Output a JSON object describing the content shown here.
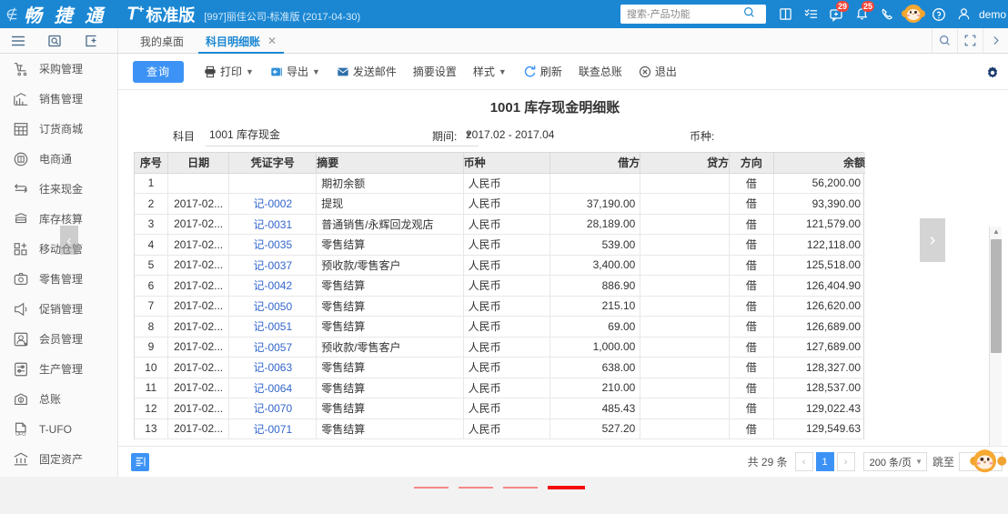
{
  "topbar": {
    "back_icon": "back-arrow-icon",
    "brand_cn": "畅 捷 通",
    "brand_t": "T",
    "brand_t_sup": "+",
    "brand_edition": "标准版",
    "company": "[997]丽佳公司-标准版  (2017-04-30)",
    "search_placeholder": "搜索-产品功能",
    "icons": [
      {
        "name": "save-icon",
        "badge": ""
      },
      {
        "name": "task-list-icon",
        "badge": ""
      },
      {
        "name": "message-icon",
        "badge": "29"
      },
      {
        "name": "bell-icon",
        "badge": "25"
      },
      {
        "name": "phone-icon",
        "badge": ""
      },
      {
        "name": "monkey-mascot-icon",
        "badge": ""
      },
      {
        "name": "help-icon",
        "badge": ""
      },
      {
        "name": "user-icon",
        "badge": ""
      }
    ],
    "username": "demo"
  },
  "tabrow": {
    "left_icons": [
      "menu-icon",
      "search-doc-icon",
      "add-doc-icon"
    ],
    "tabs": [
      {
        "label": "我的桌面",
        "active": false,
        "closable": false
      },
      {
        "label": "科目明细账",
        "active": true,
        "closable": true
      }
    ],
    "close_glyph": "✕",
    "right_icons": [
      "search-icon",
      "fullscreen-icon",
      "chevron-right-icon"
    ]
  },
  "sidebar": {
    "items": [
      {
        "label": "采购管理",
        "icon": "cart-icon"
      },
      {
        "label": "销售管理",
        "icon": "chart-up-icon"
      },
      {
        "label": "订货商城",
        "icon": "shop-icon"
      },
      {
        "label": "电商通",
        "icon": "ecommerce-icon"
      },
      {
        "label": "往来现金",
        "icon": "exchange-icon"
      },
      {
        "label": "库存核算",
        "icon": "inventory-icon"
      },
      {
        "label": "移动仓管",
        "icon": "grid-plus-icon"
      },
      {
        "label": "零售管理",
        "icon": "retail-icon"
      },
      {
        "label": "促销管理",
        "icon": "megaphone-icon"
      },
      {
        "label": "会员管理",
        "icon": "member-icon"
      },
      {
        "label": "生产管理",
        "icon": "production-icon"
      },
      {
        "label": "总账",
        "icon": "ledger-icon"
      },
      {
        "label": "T-UFO",
        "icon": "ufo-icon"
      },
      {
        "label": "固定资产",
        "icon": "bank-icon"
      }
    ],
    "collapse_glyph": "‹"
  },
  "toolbar": {
    "query_label": "查询",
    "items": [
      {
        "label": "打印",
        "icon": "printer-icon",
        "caret": true
      },
      {
        "label": "导出",
        "icon": "export-icon",
        "caret": true
      },
      {
        "label": "发送邮件",
        "icon": "mail-icon",
        "caret": false
      },
      {
        "label": "摘要设置",
        "icon": "",
        "caret": false
      },
      {
        "label": "样式",
        "icon": "",
        "caret": true
      },
      {
        "label": "刷新",
        "icon": "refresh-icon",
        "caret": false
      },
      {
        "label": "联查总账",
        "icon": "",
        "caret": false
      },
      {
        "label": "退出",
        "icon": "exit-icon",
        "caret": false
      }
    ],
    "gear_icon": "gear-icon"
  },
  "report": {
    "title": "1001 库存现金明细账",
    "subject_label": "科目",
    "subject_value": "1001 库存现金",
    "period_label": "期间:",
    "period_value": "2017.02 - 2017.04",
    "currency_label": "币种:"
  },
  "table": {
    "columns": [
      "序号",
      "日期",
      "凭证字号",
      "摘要",
      "币种",
      "借方",
      "贷方",
      "方向",
      "余额"
    ],
    "rows": [
      {
        "seq": "1",
        "date": "",
        "voucher": "",
        "digest": "期初余额",
        "currency": "人民币",
        "debit": "",
        "credit": "",
        "dir": "借",
        "balance": "56,200.00"
      },
      {
        "seq": "2",
        "date": "2017-02...",
        "voucher": "记-0002",
        "digest": "提现",
        "currency": "人民币",
        "debit": "37,190.00",
        "credit": "",
        "dir": "借",
        "balance": "93,390.00"
      },
      {
        "seq": "3",
        "date": "2017-02...",
        "voucher": "记-0031",
        "digest": "普通销售/永辉回龙观店",
        "currency": "人民币",
        "debit": "28,189.00",
        "credit": "",
        "dir": "借",
        "balance": "121,579.00"
      },
      {
        "seq": "4",
        "date": "2017-02...",
        "voucher": "记-0035",
        "digest": "零售结算",
        "currency": "人民币",
        "debit": "539.00",
        "credit": "",
        "dir": "借",
        "balance": "122,118.00"
      },
      {
        "seq": "5",
        "date": "2017-02...",
        "voucher": "记-0037",
        "digest": "预收款/零售客户",
        "currency": "人民币",
        "debit": "3,400.00",
        "credit": "",
        "dir": "借",
        "balance": "125,518.00"
      },
      {
        "seq": "6",
        "date": "2017-02...",
        "voucher": "记-0042",
        "digest": "零售结算",
        "currency": "人民币",
        "debit": "886.90",
        "credit": "",
        "dir": "借",
        "balance": "126,404.90"
      },
      {
        "seq": "7",
        "date": "2017-02...",
        "voucher": "记-0050",
        "digest": "零售结算",
        "currency": "人民币",
        "debit": "215.10",
        "credit": "",
        "dir": "借",
        "balance": "126,620.00"
      },
      {
        "seq": "8",
        "date": "2017-02...",
        "voucher": "记-0051",
        "digest": "零售结算",
        "currency": "人民币",
        "debit": "69.00",
        "credit": "",
        "dir": "借",
        "balance": "126,689.00"
      },
      {
        "seq": "9",
        "date": "2017-02...",
        "voucher": "记-0057",
        "digest": "预收款/零售客户",
        "currency": "人民币",
        "debit": "1,000.00",
        "credit": "",
        "dir": "借",
        "balance": "127,689.00"
      },
      {
        "seq": "10",
        "date": "2017-02...",
        "voucher": "记-0063",
        "digest": "零售结算",
        "currency": "人民币",
        "debit": "638.00",
        "credit": "",
        "dir": "借",
        "balance": "128,327.00"
      },
      {
        "seq": "11",
        "date": "2017-02...",
        "voucher": "记-0064",
        "digest": "零售结算",
        "currency": "人民币",
        "debit": "210.00",
        "credit": "",
        "dir": "借",
        "balance": "128,537.00"
      },
      {
        "seq": "12",
        "date": "2017-02...",
        "voucher": "记-0070",
        "digest": "零售结算",
        "currency": "人民币",
        "debit": "485.43",
        "credit": "",
        "dir": "借",
        "balance": "129,022.43"
      },
      {
        "seq": "13",
        "date": "2017-02...",
        "voucher": "记-0071",
        "digest": "零售结算",
        "currency": "人民币",
        "debit": "527.20",
        "credit": "",
        "dir": "借",
        "balance": "129,549.63"
      }
    ]
  },
  "nav": {
    "next_glyph": "›"
  },
  "footer": {
    "list_icon": "list-view-icon",
    "total_text": "共 29 条",
    "prev_glyph": "‹",
    "current_page": "1",
    "next_glyph": "›",
    "page_size": "200 条/页",
    "jump_label": "跳至",
    "jump_value": ""
  },
  "colors": {
    "brand_blue": "#1b87d3",
    "accent_blue": "#3d93f5",
    "badge_red": "#f44336",
    "link_blue": "#3366cc",
    "dash_red": "#f40b0b"
  }
}
